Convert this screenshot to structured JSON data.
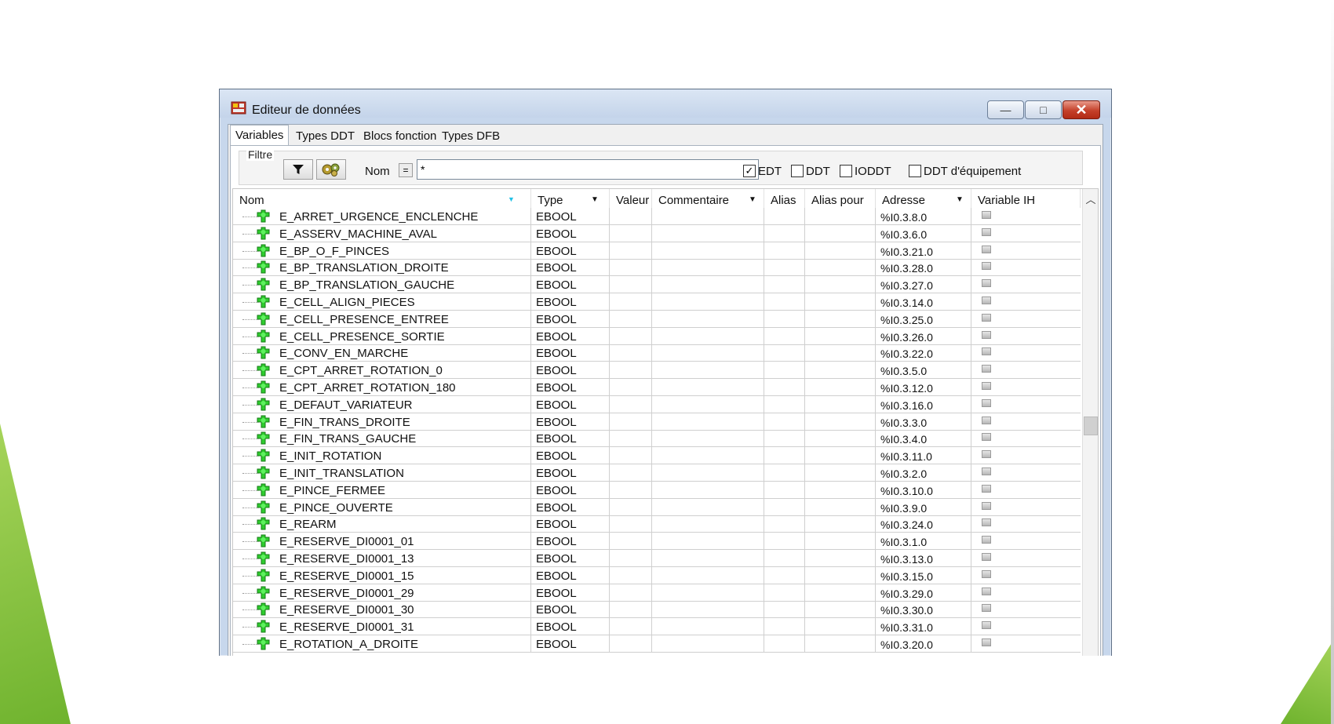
{
  "window": {
    "title": "Editeur de données",
    "minimize_glyph": "—",
    "maximize_glyph": "□",
    "close_glyph": "✕"
  },
  "tabs": [
    {
      "label": "Variables",
      "active": true
    },
    {
      "label": "Types DDT",
      "active": false
    },
    {
      "label": "Blocs fonction",
      "active": false
    },
    {
      "label": "Types DFB",
      "active": false
    }
  ],
  "filter": {
    "group_label": "Filtre",
    "name_label": "Nom",
    "equals_label": "=",
    "value": "*",
    "checkboxes": [
      {
        "label": "EDT",
        "checked": true
      },
      {
        "label": "DDT",
        "checked": false
      },
      {
        "label": "IODDT",
        "checked": false
      },
      {
        "label": "DDT d'équipement",
        "checked": false
      }
    ]
  },
  "table": {
    "columns": [
      "Nom",
      "Type",
      "Valeur",
      "Commentaire",
      "Alias",
      "Alias pour",
      "Adresse",
      "Variable IH"
    ],
    "rows": [
      {
        "name": "E_ARRET_URGENCE_ENCLENCHE",
        "type": "EBOOL",
        "address": "%I0.3.8.0"
      },
      {
        "name": "E_ASSERV_MACHINE_AVAL",
        "type": "EBOOL",
        "address": "%I0.3.6.0"
      },
      {
        "name": "E_BP_O_F_PINCES",
        "type": "EBOOL",
        "address": "%I0.3.21.0"
      },
      {
        "name": "E_BP_TRANSLATION_DROITE",
        "type": "EBOOL",
        "address": "%I0.3.28.0"
      },
      {
        "name": "E_BP_TRANSLATION_GAUCHE",
        "type": "EBOOL",
        "address": "%I0.3.27.0"
      },
      {
        "name": "E_CELL_ALIGN_PIECES",
        "type": "EBOOL",
        "address": "%I0.3.14.0"
      },
      {
        "name": "E_CELL_PRESENCE_ENTREE",
        "type": "EBOOL",
        "address": "%I0.3.25.0"
      },
      {
        "name": "E_CELL_PRESENCE_SORTIE",
        "type": "EBOOL",
        "address": "%I0.3.26.0"
      },
      {
        "name": "E_CONV_EN_MARCHE",
        "type": "EBOOL",
        "address": "%I0.3.22.0"
      },
      {
        "name": "E_CPT_ARRET_ROTATION_0",
        "type": "EBOOL",
        "address": "%I0.3.5.0"
      },
      {
        "name": "E_CPT_ARRET_ROTATION_180",
        "type": "EBOOL",
        "address": "%I0.3.12.0"
      },
      {
        "name": "E_DEFAUT_VARIATEUR",
        "type": "EBOOL",
        "address": "%I0.3.16.0"
      },
      {
        "name": "E_FIN_TRANS_DROITE",
        "type": "EBOOL",
        "address": "%I0.3.3.0"
      },
      {
        "name": "E_FIN_TRANS_GAUCHE",
        "type": "EBOOL",
        "address": "%I0.3.4.0"
      },
      {
        "name": "E_INIT_ROTATION",
        "type": "EBOOL",
        "address": "%I0.3.11.0"
      },
      {
        "name": "E_INIT_TRANSLATION",
        "type": "EBOOL",
        "address": "%I0.3.2.0"
      },
      {
        "name": "E_PINCE_FERMEE",
        "type": "EBOOL",
        "address": "%I0.3.10.0"
      },
      {
        "name": "E_PINCE_OUVERTE",
        "type": "EBOOL",
        "address": "%I0.3.9.0"
      },
      {
        "name": "E_REARM",
        "type": "EBOOL",
        "address": "%I0.3.24.0"
      },
      {
        "name": "E_RESERVE_DI0001_01",
        "type": "EBOOL",
        "address": "%I0.3.1.0"
      },
      {
        "name": "E_RESERVE_DI0001_13",
        "type": "EBOOL",
        "address": "%I0.3.13.0"
      },
      {
        "name": "E_RESERVE_DI0001_15",
        "type": "EBOOL",
        "address": "%I0.3.15.0"
      },
      {
        "name": "E_RESERVE_DI0001_29",
        "type": "EBOOL",
        "address": "%I0.3.29.0"
      },
      {
        "name": "E_RESERVE_DI0001_30",
        "type": "EBOOL",
        "address": "%I0.3.30.0"
      },
      {
        "name": "E_RESERVE_DI0001_31",
        "type": "EBOOL",
        "address": "%I0.3.31.0"
      },
      {
        "name": "E_ROTATION_A_DROITE",
        "type": "EBOOL",
        "address": "%I0.3.20.0"
      }
    ]
  },
  "colors": {
    "title_bar": "#c7d7ec",
    "close_button": "#c4402a",
    "variable_icon": "#2ecc2e",
    "slide_accent": "#8cc63f"
  }
}
